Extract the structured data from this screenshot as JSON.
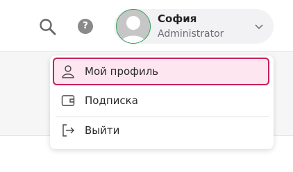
{
  "header": {
    "search_icon": "search-icon",
    "help_label": "?",
    "user": {
      "name": "София",
      "role": "Administrator",
      "avatar_icon": "person-silhouette-icon",
      "avatar_ring_color": "#2d9b59"
    },
    "chevron_icon": "chevron-down-icon"
  },
  "menu": {
    "accent_color": "#c81e5a",
    "items": [
      {
        "label": "Мой профиль",
        "icon": "user-icon",
        "active": true
      },
      {
        "label": "Подписка",
        "icon": "wallet-icon",
        "active": false
      },
      {
        "label": "Выйти",
        "icon": "logout-icon",
        "active": false
      }
    ]
  }
}
